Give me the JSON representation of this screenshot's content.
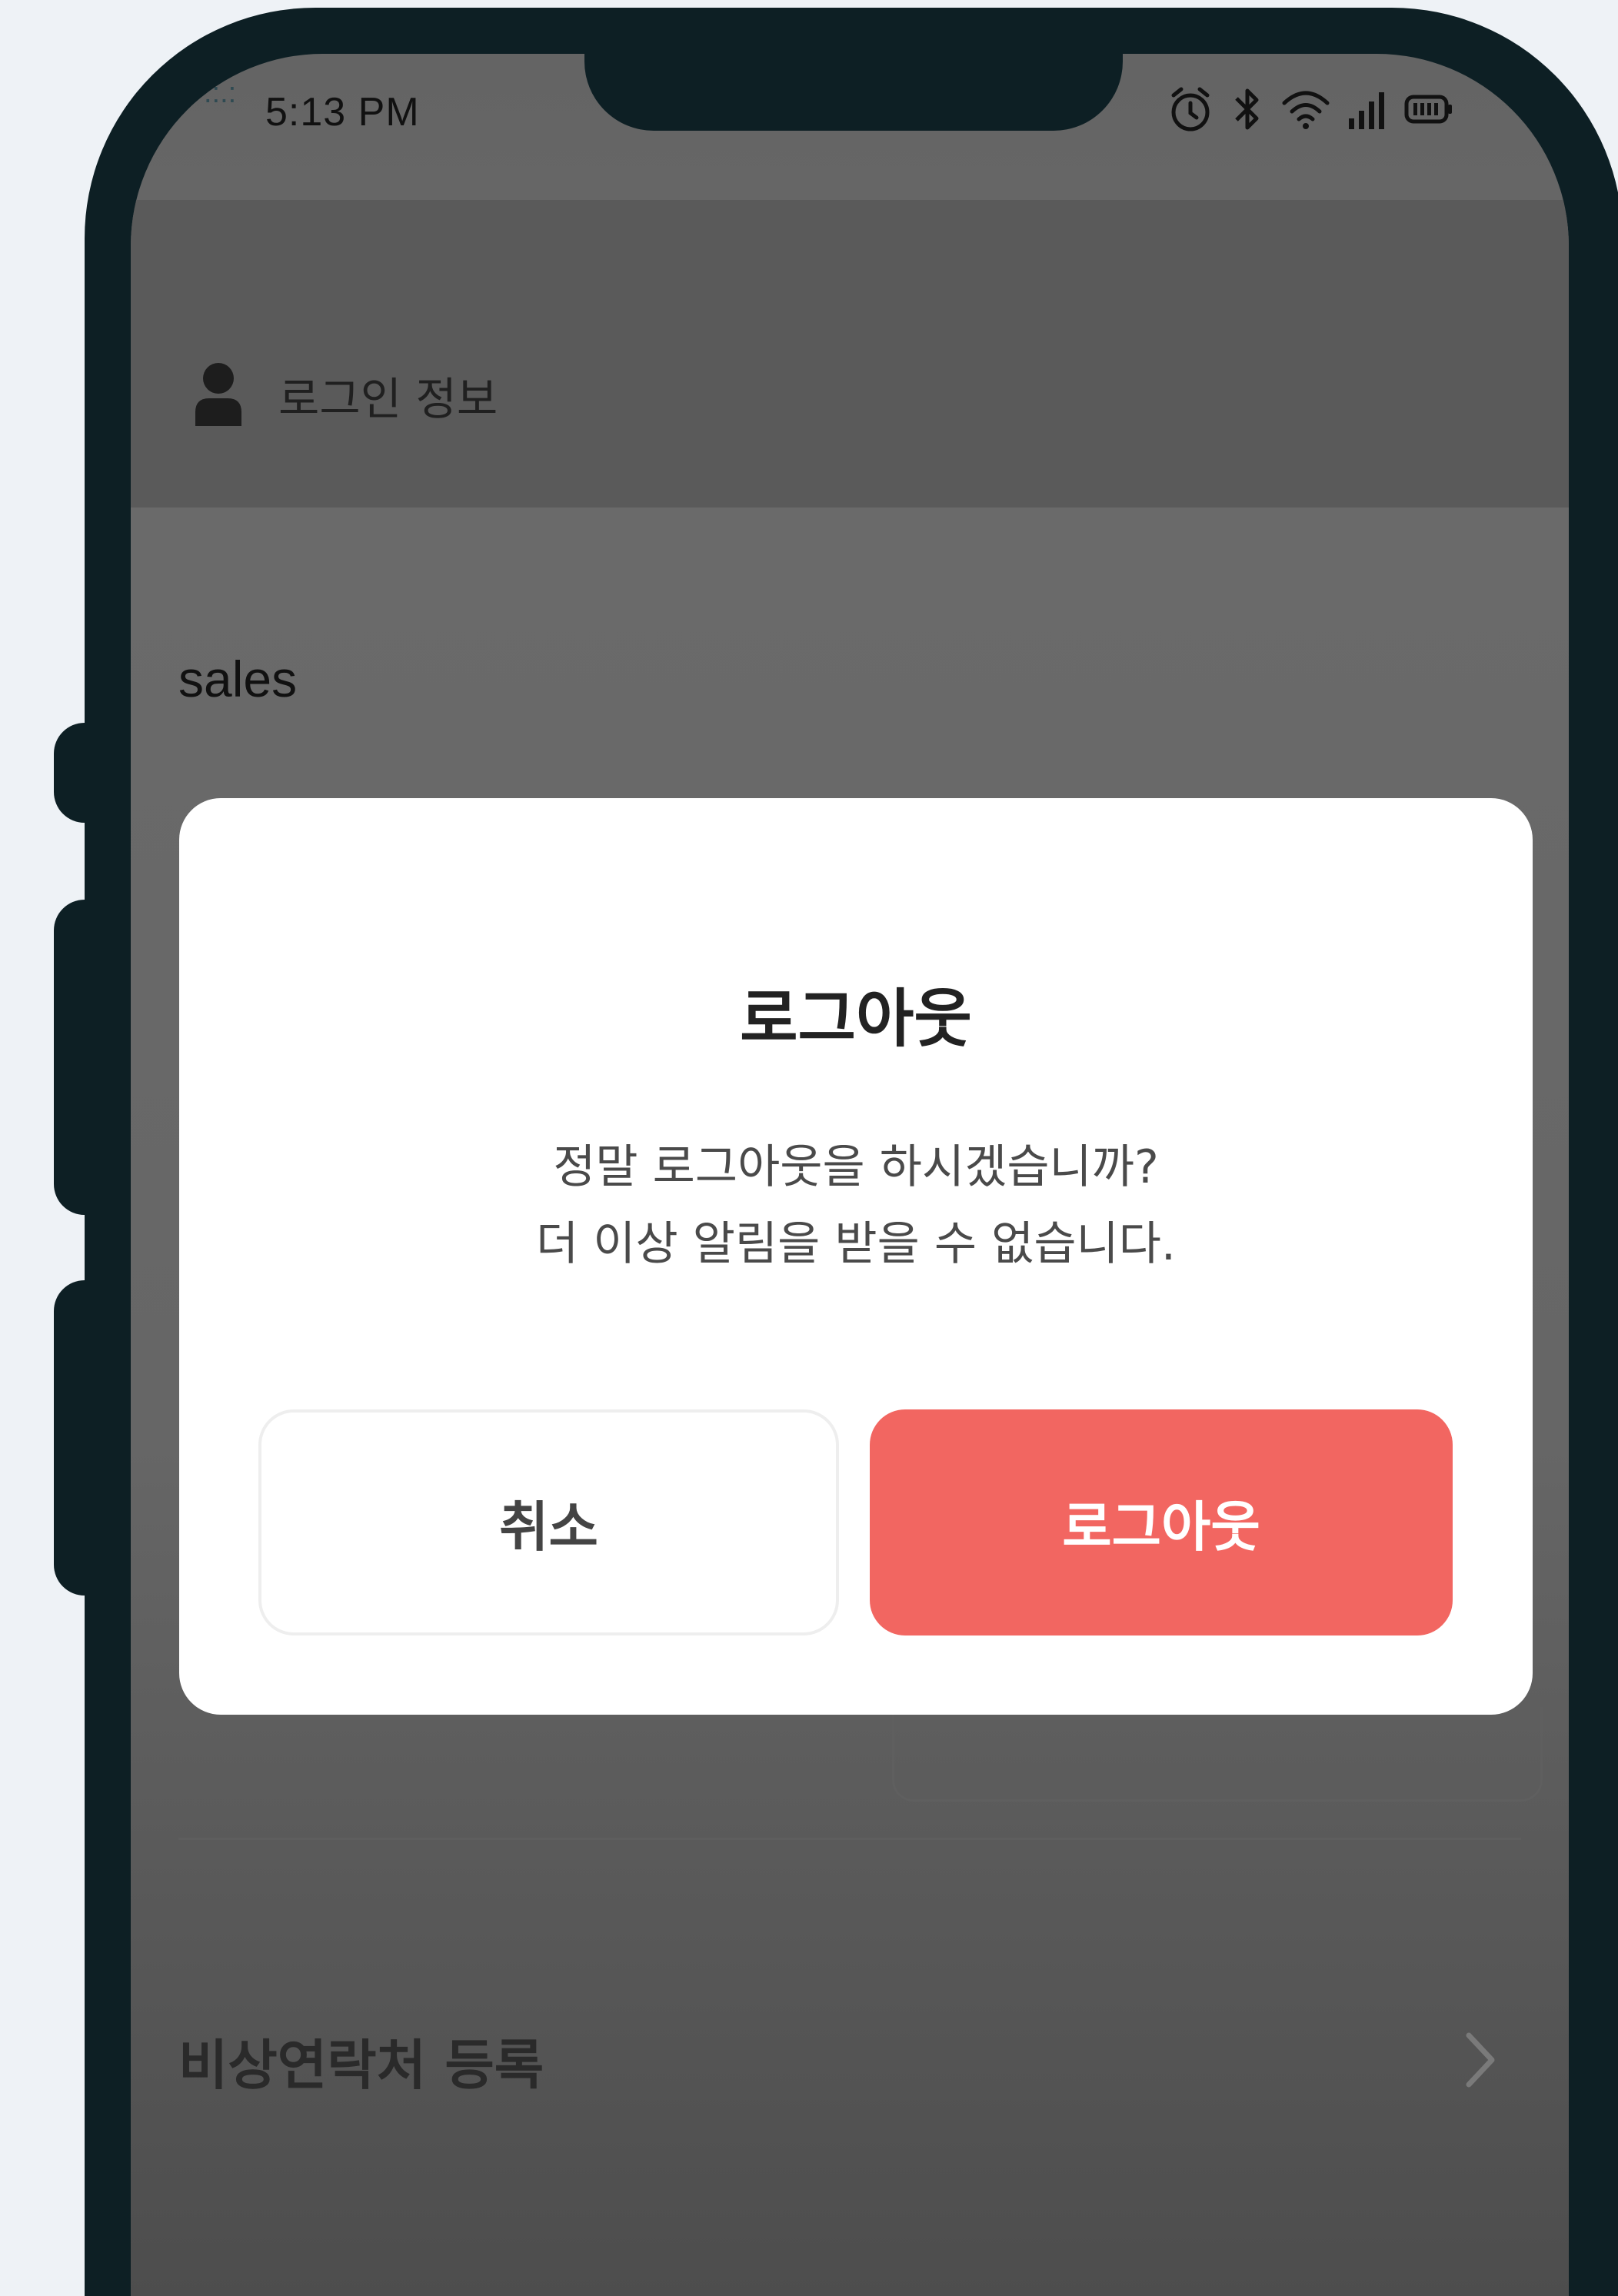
{
  "status_bar": {
    "signal_glitch": ".:.:",
    "time": "5:13 PM",
    "icons": [
      "alarm-icon",
      "bluetooth-icon",
      "wifi-icon",
      "signal-icon",
      "battery-icon"
    ]
  },
  "header": {
    "icon": "person-icon",
    "title": "로그인 정보"
  },
  "account": {
    "username": "sales"
  },
  "menu": {
    "emergency_contact_label": "비상연락처 등록",
    "chevron_icon": "chevron-right-icon"
  },
  "dialog": {
    "title": "로그아웃",
    "message_line1": "정말 로그아웃을 하시겠습니까?",
    "message_line2": "더 이상 알림을 받을 수 없습니다.",
    "cancel_label": "취소",
    "confirm_label": "로그아웃"
  },
  "colors": {
    "phone_frame": "#0d1f24",
    "overlay_bg": "#666666",
    "confirm_button": "#f26661",
    "page_bg": "#eef2f6"
  }
}
